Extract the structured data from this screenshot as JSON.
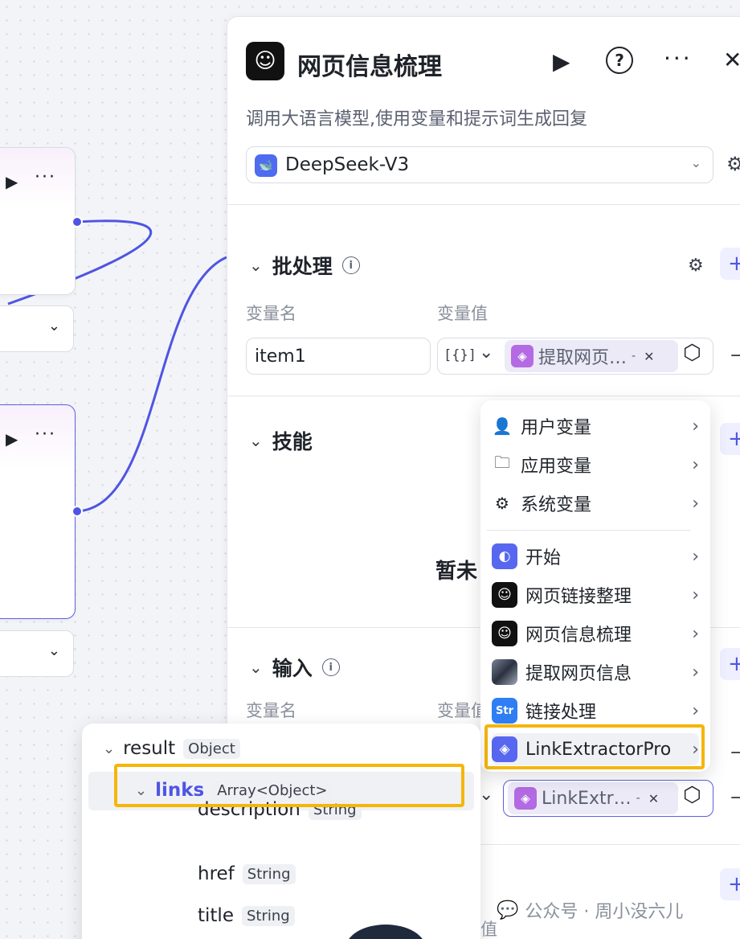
{
  "panel": {
    "title": "网页信息梳理",
    "description": "调用大语言模型,使用变量和提示词生成回复",
    "model": "DeepSeek-V3"
  },
  "batch": {
    "title": "批处理",
    "col_name": "变量名",
    "col_value": "变量值",
    "row": {
      "name": "item1",
      "type_icon": "[{}]",
      "chip": "提取网页…",
      "chip_sep": "-"
    }
  },
  "skills": {
    "title": "技能",
    "empty_text": "暂未"
  },
  "input": {
    "title": "输入",
    "col_name": "变量名",
    "col_value": "变量值",
    "row": {
      "chip": "LinkExtr…",
      "chip_sep": "-"
    }
  },
  "menu": {
    "items": [
      {
        "label": "用户变量",
        "icon": "user-icon"
      },
      {
        "label": "应用变量",
        "icon": "folder-icon"
      },
      {
        "label": "系统变量",
        "icon": "gear-icon"
      },
      {
        "label": "开始",
        "icon": "start-node-icon"
      },
      {
        "label": "网页链接整理",
        "icon": "bot-icon"
      },
      {
        "label": "网页信息梳理",
        "icon": "bot-icon"
      },
      {
        "label": "提取网页信息",
        "icon": "image-node-icon"
      },
      {
        "label": "链接处理",
        "icon": "str-node-icon"
      },
      {
        "label": "LinkExtractorPro",
        "icon": "cube-icon"
      }
    ]
  },
  "tree": {
    "rows": [
      {
        "name": "result",
        "type": "Object"
      },
      {
        "name": "links",
        "type": "Array<Object>"
      },
      {
        "name": "description",
        "type": "String"
      },
      {
        "name": "href",
        "type": "String"
      },
      {
        "name": "title",
        "type": "String"
      }
    ]
  },
  "partial_value_label": "值",
  "watermark": "公众号 · 周小没六儿",
  "colors": {
    "accent": "#4f55e3",
    "highlight": "#f5b60a",
    "chip_bg": "#eceaf7"
  }
}
